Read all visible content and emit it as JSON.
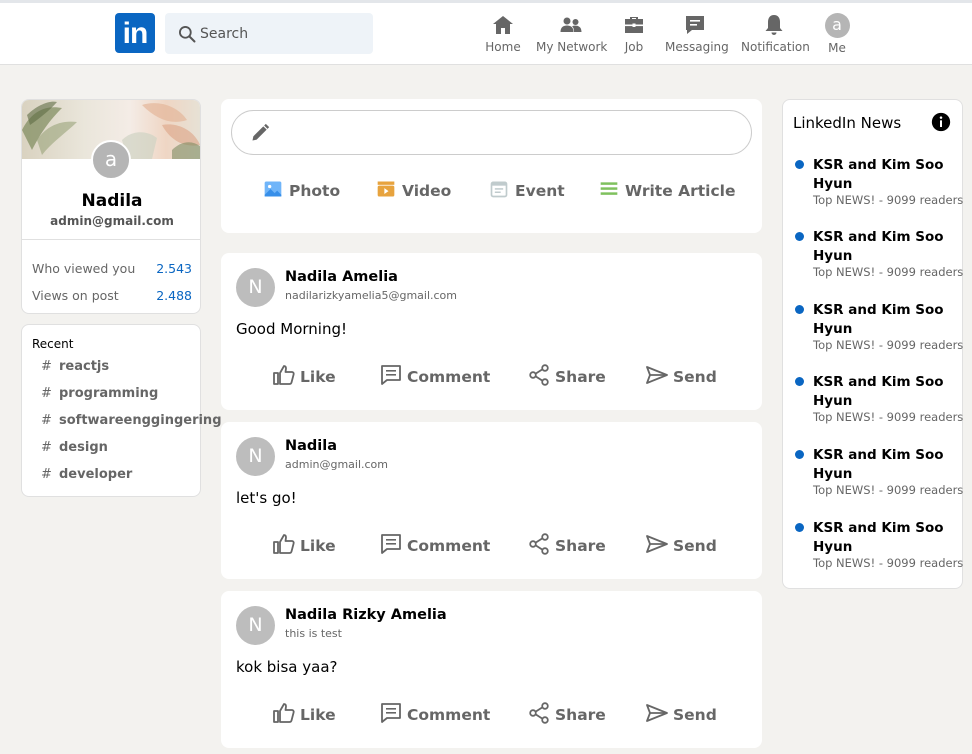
{
  "header": {
    "logo_text": "in",
    "search": {
      "placeholder": "Search"
    },
    "nav": [
      {
        "label": "Home",
        "icon": "home-icon"
      },
      {
        "label": "My Network",
        "icon": "network-icon"
      },
      {
        "label": "Job",
        "icon": "briefcase-icon"
      },
      {
        "label": "Messaging",
        "icon": "messaging-icon"
      },
      {
        "label": "Notification",
        "icon": "bell-icon"
      },
      {
        "label": "Me",
        "icon": "avatar",
        "avatar_letter": "a"
      }
    ]
  },
  "profile": {
    "avatar_letter": "a",
    "name": "Nadila",
    "email": "admin@gmail.com",
    "stats": [
      {
        "label": "Who viewed you",
        "value": "2.543"
      },
      {
        "label": "Views on post",
        "value": "2.488"
      }
    ]
  },
  "recent": {
    "title": "Recent",
    "hash": "#",
    "items": [
      "reactjs",
      "programming",
      "softwareenggingering",
      "design",
      "developer"
    ]
  },
  "share": {
    "input_placeholder": "",
    "actions": [
      {
        "label": "Photo",
        "icon": "photo-icon",
        "color": "#70b5f9"
      },
      {
        "label": "Video",
        "icon": "video-icon",
        "color": "#e7a33e"
      },
      {
        "label": "Event",
        "icon": "event-icon",
        "color": "#c0cbcd"
      },
      {
        "label": "Write Article",
        "icon": "article-icon",
        "color": "#7fc15e"
      }
    ]
  },
  "post_actions": [
    "Like",
    "Comment",
    "Share",
    "Send"
  ],
  "posts": [
    {
      "avatar_letter": "N",
      "name": "Nadila Amelia",
      "subtitle": "nadilarizkyamelia5@gmail.com",
      "message": "Good Morning!"
    },
    {
      "avatar_letter": "N",
      "name": "Nadila",
      "subtitle": "admin@gmail.com",
      "message": "let's go!"
    },
    {
      "avatar_letter": "N",
      "name": "Nadila Rizky Amelia",
      "subtitle": "this is test",
      "message": "kok bisa yaa?"
    }
  ],
  "news": {
    "title": "LinkedIn News",
    "items": [
      {
        "headline": "KSR and Kim Soo Hyun",
        "meta": "Top NEWS! - 9099 readers"
      },
      {
        "headline": "KSR and Kim Soo Hyun",
        "meta": "Top NEWS! - 9099 readers"
      },
      {
        "headline": "KSR and Kim Soo Hyun",
        "meta": "Top NEWS! - 9099 readers"
      },
      {
        "headline": "KSR and Kim Soo Hyun",
        "meta": "Top NEWS! - 9099 readers"
      },
      {
        "headline": "KSR and Kim Soo Hyun",
        "meta": "Top NEWS! - 9099 readers"
      },
      {
        "headline": "KSR and Kim Soo Hyun",
        "meta": "Top NEWS! - 9099 readers"
      }
    ]
  },
  "colors": {
    "brand": "#0a66c2",
    "background": "#f3f2ef",
    "muted_text": "#666666"
  }
}
